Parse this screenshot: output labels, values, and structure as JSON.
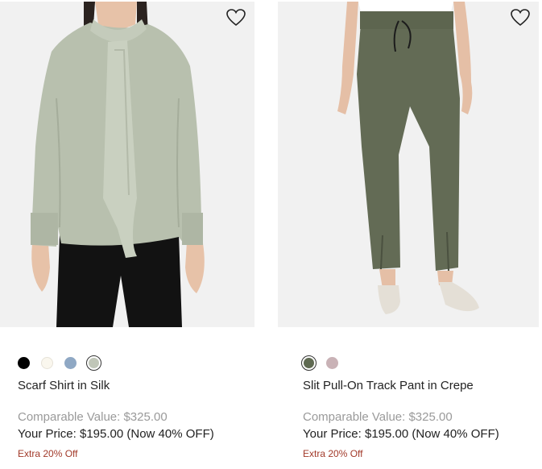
{
  "products": [
    {
      "title": "Scarf Shirt in Silk",
      "comparable_value": "Comparable Value: $325.00",
      "your_price": "Your Price: $195.00 (Now 40% OFF)",
      "promo": "Extra 20% Off",
      "wishlist_icon": "heart-icon",
      "swatches": [
        {
          "color": "#000000",
          "selected": false
        },
        {
          "color": "#faf7ee",
          "selected": false
        },
        {
          "color": "#8fa8c4",
          "selected": false
        },
        {
          "color": "#c0c6b8",
          "selected": true
        }
      ]
    },
    {
      "title": "Slit Pull-On Track Pant in Crepe",
      "comparable_value": "Comparable Value: $325.00",
      "your_price": "Your Price: $195.00 (Now 40% OFF)",
      "promo": "Extra 20% Off",
      "wishlist_icon": "heart-icon",
      "swatches": [
        {
          "color": "#5f6a52",
          "selected": true
        },
        {
          "color": "#c9b2b6",
          "selected": false
        }
      ]
    }
  ],
  "colors": {
    "image_background": "#f1f1f1",
    "promo_text": "#a23a2a",
    "muted_text": "#9a9a9a"
  }
}
